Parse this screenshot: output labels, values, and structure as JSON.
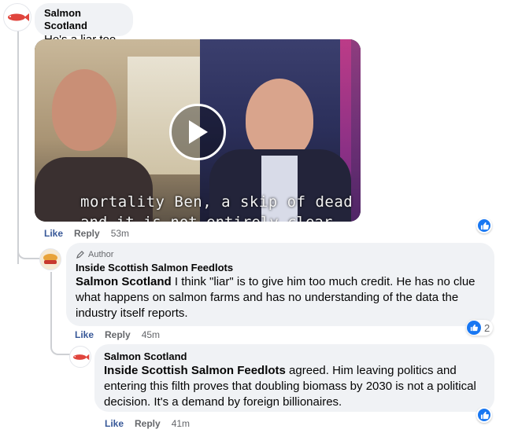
{
  "comments": [
    {
      "author": "Salmon Scotland",
      "text": "He's a liar too.",
      "video": {
        "caption_line1": "mortality Ben, a skip of dead fis",
        "caption_line2": "and it is not entirely clear"
      },
      "actions": {
        "like": "Like",
        "reply": "Reply",
        "time": "53m"
      }
    },
    {
      "author_tag": "Author",
      "author": "Inside Scottish Salmon Feedlots",
      "mention": "Salmon Scotland",
      "text": " I think \"liar\" is to give him too much credit. He has no clue what happens on salmon farms and has no understanding of the data the industry itself reports.",
      "reaction_count": "2",
      "actions": {
        "like": "Like",
        "reply": "Reply",
        "time": "45m"
      }
    },
    {
      "author": "Salmon Scotland",
      "mention": "Inside Scottish Salmon Feedlots",
      "text": " agreed. Him leaving politics and entering this filth proves that doubling biomass by 2030 is not a political decision. It's a demand by foreign billionaires.",
      "actions": {
        "like": "Like",
        "reply": "Reply",
        "time": "41m"
      }
    }
  ],
  "colors": {
    "like_blue": "#1877f2",
    "bubble": "#f0f2f5",
    "thread_line": "#ced0d4"
  }
}
